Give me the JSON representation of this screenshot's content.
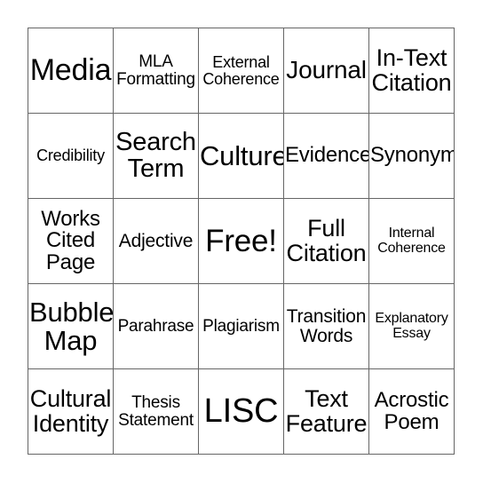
{
  "card": {
    "type": "bingo-card",
    "columns": 5,
    "rows": 5,
    "free_space": {
      "row": 3,
      "column": 3,
      "label": "Free!"
    },
    "colors": {
      "background": "#ffffff",
      "grid_line": "#666666",
      "text": "#000000"
    },
    "cells": [
      [
        {
          "text": "Media",
          "size": "fs-34",
          "lines": 1
        },
        {
          "text": "MLA\nFormatting",
          "size": "fs-19",
          "lines": 2
        },
        {
          "text": "External\nCoherence",
          "size": "fs-18",
          "lines": 2
        },
        {
          "text": "Journal",
          "size": "fs-28",
          "lines": 1
        },
        {
          "text": "In-Text\nCitation",
          "size": "fs-27",
          "lines": 2
        }
      ],
      [
        {
          "text": "Credibility",
          "size": "fs-18",
          "lines": 1
        },
        {
          "text": "Search\nTerm",
          "size": "fs-29",
          "lines": 2
        },
        {
          "text": "Culture",
          "size": "fs-31",
          "lines": 1
        },
        {
          "text": "Evidence",
          "size": "fs-24",
          "lines": 1
        },
        {
          "text": "Synonym",
          "size": "fs-24",
          "lines": 1
        }
      ],
      [
        {
          "text": "Works\nCited\nPage",
          "size": "fs-24",
          "lines": 3
        },
        {
          "text": "Adjective",
          "size": "fs-21",
          "lines": 1
        },
        {
          "text": "Free!",
          "size": "fs-35",
          "lines": 1
        },
        {
          "text": "Full\nCitation",
          "size": "fs-27",
          "lines": 2
        },
        {
          "text": "Internal\nCoherence",
          "size": "fs-16",
          "lines": 2
        }
      ],
      [
        {
          "text": "Bubble\nMap",
          "size": "fs-31",
          "lines": 2
        },
        {
          "text": "Parahrase",
          "size": "fs-19",
          "lines": 1
        },
        {
          "text": "Plagiarism",
          "size": "fs-19",
          "lines": 1
        },
        {
          "text": "Transition\nWords",
          "size": "fs-21",
          "lines": 2
        },
        {
          "text": "Explanatory\nEssay",
          "size": "fs-16",
          "lines": 2
        }
      ],
      [
        {
          "text": "Cultural\nIdentity",
          "size": "fs-27",
          "lines": 2
        },
        {
          "text": "Thesis\nStatement",
          "size": "fs-19",
          "lines": 2
        },
        {
          "text": "LISC",
          "size": "fs-38",
          "lines": 1
        },
        {
          "text": "Text\nFeature",
          "size": "fs-27",
          "lines": 2
        },
        {
          "text": "Acrostic\nPoem",
          "size": "fs-24",
          "lines": 2
        }
      ]
    ]
  }
}
